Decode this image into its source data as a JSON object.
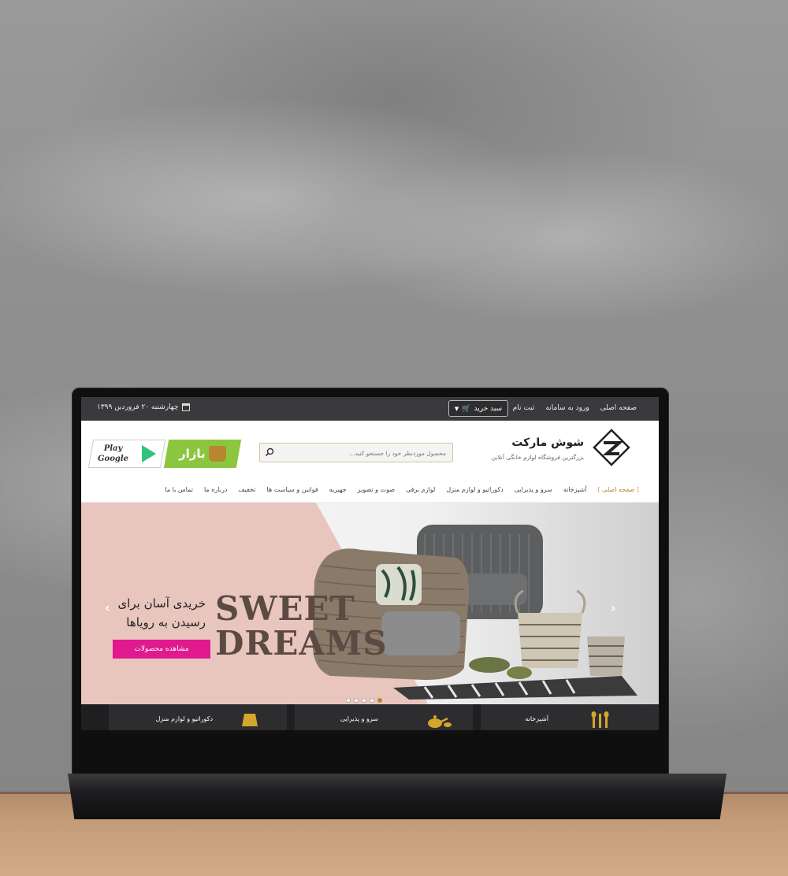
{
  "topbar": {
    "links": [
      "صفحه اصلی",
      "ورود به سامانه",
      "ثبت نام"
    ],
    "cart_label": "سبد خرید",
    "date": "چهارشنبه ۲۰ فروردین ۱۳۹۹"
  },
  "header": {
    "title": "شوش مارکت",
    "subtitle": "بزرگترین فروشگاه لوازم خانگی آنلاین",
    "search_placeholder": "محصول موردنظر خود را جستجو کنید...",
    "bazaar_label": "بازار",
    "gplay_line1": "Play",
    "gplay_line2": "Google"
  },
  "nav": {
    "items": [
      "صفحه اصلی",
      "آشپزخانه",
      "سرو و پذیرایی",
      "دکوراتیو و لوازم منزل",
      "لوازم برقی",
      "صوت و تصویر",
      "جهیزیه",
      "قوانین و سیاست ها",
      "تخفیف",
      "درباره ما",
      "تماس با ما"
    ],
    "active_index": 0
  },
  "slider": {
    "line1": "خریدی آسان برای",
    "line2": "رسیدن به رویاها",
    "word1": "SWEET",
    "word2": "DREAMS",
    "cta": "مشاهده محصولات",
    "slide_count": 5,
    "active_slide": 4
  },
  "categories": [
    "آشپزخانه",
    "سرو و پذیرایی",
    "دکوراتیو و لوازم منزل"
  ],
  "colors": {
    "accent": "#b8862f",
    "cta": "#e0198e",
    "topbar": "#3a3a3d",
    "bazaar": "#8cc63f"
  }
}
